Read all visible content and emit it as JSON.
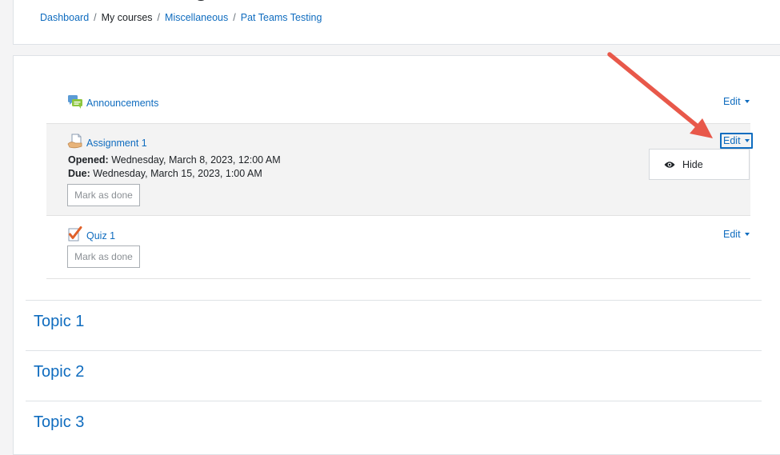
{
  "header": {
    "title_fragment": "g",
    "breadcrumb": {
      "dashboard": "Dashboard",
      "my_courses": "My courses",
      "category": "Miscellaneous",
      "course": "Pat Teams Testing"
    }
  },
  "activities": {
    "announcements": {
      "name": "Announcements",
      "edit_label": "Edit"
    },
    "assignment": {
      "name": "Assignment 1",
      "opened_label": "Opened:",
      "opened_value": "Wednesday, March 8, 2023, 12:00 AM",
      "due_label": "Due:",
      "due_value": "Wednesday, March 15, 2023, 1:00 AM",
      "mark_done": "Mark as done",
      "edit_label": "Edit",
      "menu": {
        "hide": "Hide"
      }
    },
    "quiz": {
      "name": "Quiz 1",
      "mark_done": "Mark as done",
      "edit_label": "Edit"
    }
  },
  "sections": [
    "Topic 1",
    "Topic 2",
    "Topic 3"
  ],
  "colors": {
    "link": "#0f6cbf",
    "annotation_arrow": "#e8584a"
  }
}
